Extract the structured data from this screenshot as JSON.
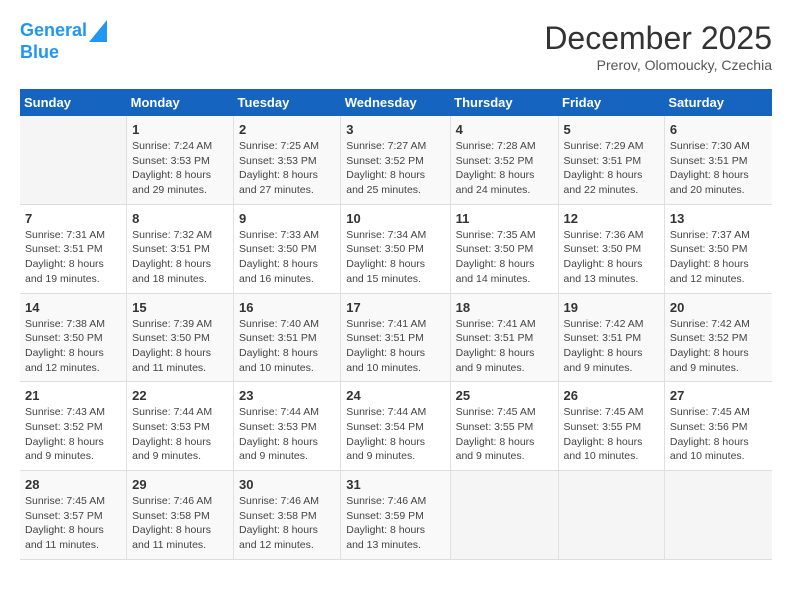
{
  "logo": {
    "line1": "General",
    "line2": "Blue"
  },
  "title": "December 2025",
  "location": "Prerov, Olomoucky, Czechia",
  "days_of_week": [
    "Sunday",
    "Monday",
    "Tuesday",
    "Wednesday",
    "Thursday",
    "Friday",
    "Saturday"
  ],
  "weeks": [
    [
      {
        "day": "",
        "info": ""
      },
      {
        "day": "1",
        "info": "Sunrise: 7:24 AM\nSunset: 3:53 PM\nDaylight: 8 hours\nand 29 minutes."
      },
      {
        "day": "2",
        "info": "Sunrise: 7:25 AM\nSunset: 3:53 PM\nDaylight: 8 hours\nand 27 minutes."
      },
      {
        "day": "3",
        "info": "Sunrise: 7:27 AM\nSunset: 3:52 PM\nDaylight: 8 hours\nand 25 minutes."
      },
      {
        "day": "4",
        "info": "Sunrise: 7:28 AM\nSunset: 3:52 PM\nDaylight: 8 hours\nand 24 minutes."
      },
      {
        "day": "5",
        "info": "Sunrise: 7:29 AM\nSunset: 3:51 PM\nDaylight: 8 hours\nand 22 minutes."
      },
      {
        "day": "6",
        "info": "Sunrise: 7:30 AM\nSunset: 3:51 PM\nDaylight: 8 hours\nand 20 minutes."
      }
    ],
    [
      {
        "day": "7",
        "info": "Sunrise: 7:31 AM\nSunset: 3:51 PM\nDaylight: 8 hours\nand 19 minutes."
      },
      {
        "day": "8",
        "info": "Sunrise: 7:32 AM\nSunset: 3:51 PM\nDaylight: 8 hours\nand 18 minutes."
      },
      {
        "day": "9",
        "info": "Sunrise: 7:33 AM\nSunset: 3:50 PM\nDaylight: 8 hours\nand 16 minutes."
      },
      {
        "day": "10",
        "info": "Sunrise: 7:34 AM\nSunset: 3:50 PM\nDaylight: 8 hours\nand 15 minutes."
      },
      {
        "day": "11",
        "info": "Sunrise: 7:35 AM\nSunset: 3:50 PM\nDaylight: 8 hours\nand 14 minutes."
      },
      {
        "day": "12",
        "info": "Sunrise: 7:36 AM\nSunset: 3:50 PM\nDaylight: 8 hours\nand 13 minutes."
      },
      {
        "day": "13",
        "info": "Sunrise: 7:37 AM\nSunset: 3:50 PM\nDaylight: 8 hours\nand 12 minutes."
      }
    ],
    [
      {
        "day": "14",
        "info": "Sunrise: 7:38 AM\nSunset: 3:50 PM\nDaylight: 8 hours\nand 12 minutes."
      },
      {
        "day": "15",
        "info": "Sunrise: 7:39 AM\nSunset: 3:50 PM\nDaylight: 8 hours\nand 11 minutes."
      },
      {
        "day": "16",
        "info": "Sunrise: 7:40 AM\nSunset: 3:51 PM\nDaylight: 8 hours\nand 10 minutes."
      },
      {
        "day": "17",
        "info": "Sunrise: 7:41 AM\nSunset: 3:51 PM\nDaylight: 8 hours\nand 10 minutes."
      },
      {
        "day": "18",
        "info": "Sunrise: 7:41 AM\nSunset: 3:51 PM\nDaylight: 8 hours\nand 9 minutes."
      },
      {
        "day": "19",
        "info": "Sunrise: 7:42 AM\nSunset: 3:51 PM\nDaylight: 8 hours\nand 9 minutes."
      },
      {
        "day": "20",
        "info": "Sunrise: 7:42 AM\nSunset: 3:52 PM\nDaylight: 8 hours\nand 9 minutes."
      }
    ],
    [
      {
        "day": "21",
        "info": "Sunrise: 7:43 AM\nSunset: 3:52 PM\nDaylight: 8 hours\nand 9 minutes."
      },
      {
        "day": "22",
        "info": "Sunrise: 7:44 AM\nSunset: 3:53 PM\nDaylight: 8 hours\nand 9 minutes."
      },
      {
        "day": "23",
        "info": "Sunrise: 7:44 AM\nSunset: 3:53 PM\nDaylight: 8 hours\nand 9 minutes."
      },
      {
        "day": "24",
        "info": "Sunrise: 7:44 AM\nSunset: 3:54 PM\nDaylight: 8 hours\nand 9 minutes."
      },
      {
        "day": "25",
        "info": "Sunrise: 7:45 AM\nSunset: 3:55 PM\nDaylight: 8 hours\nand 9 minutes."
      },
      {
        "day": "26",
        "info": "Sunrise: 7:45 AM\nSunset: 3:55 PM\nDaylight: 8 hours\nand 10 minutes."
      },
      {
        "day": "27",
        "info": "Sunrise: 7:45 AM\nSunset: 3:56 PM\nDaylight: 8 hours\nand 10 minutes."
      }
    ],
    [
      {
        "day": "28",
        "info": "Sunrise: 7:45 AM\nSunset: 3:57 PM\nDaylight: 8 hours\nand 11 minutes."
      },
      {
        "day": "29",
        "info": "Sunrise: 7:46 AM\nSunset: 3:58 PM\nDaylight: 8 hours\nand 11 minutes."
      },
      {
        "day": "30",
        "info": "Sunrise: 7:46 AM\nSunset: 3:58 PM\nDaylight: 8 hours\nand 12 minutes."
      },
      {
        "day": "31",
        "info": "Sunrise: 7:46 AM\nSunset: 3:59 PM\nDaylight: 8 hours\nand 13 minutes."
      },
      {
        "day": "",
        "info": ""
      },
      {
        "day": "",
        "info": ""
      },
      {
        "day": "",
        "info": ""
      }
    ]
  ]
}
